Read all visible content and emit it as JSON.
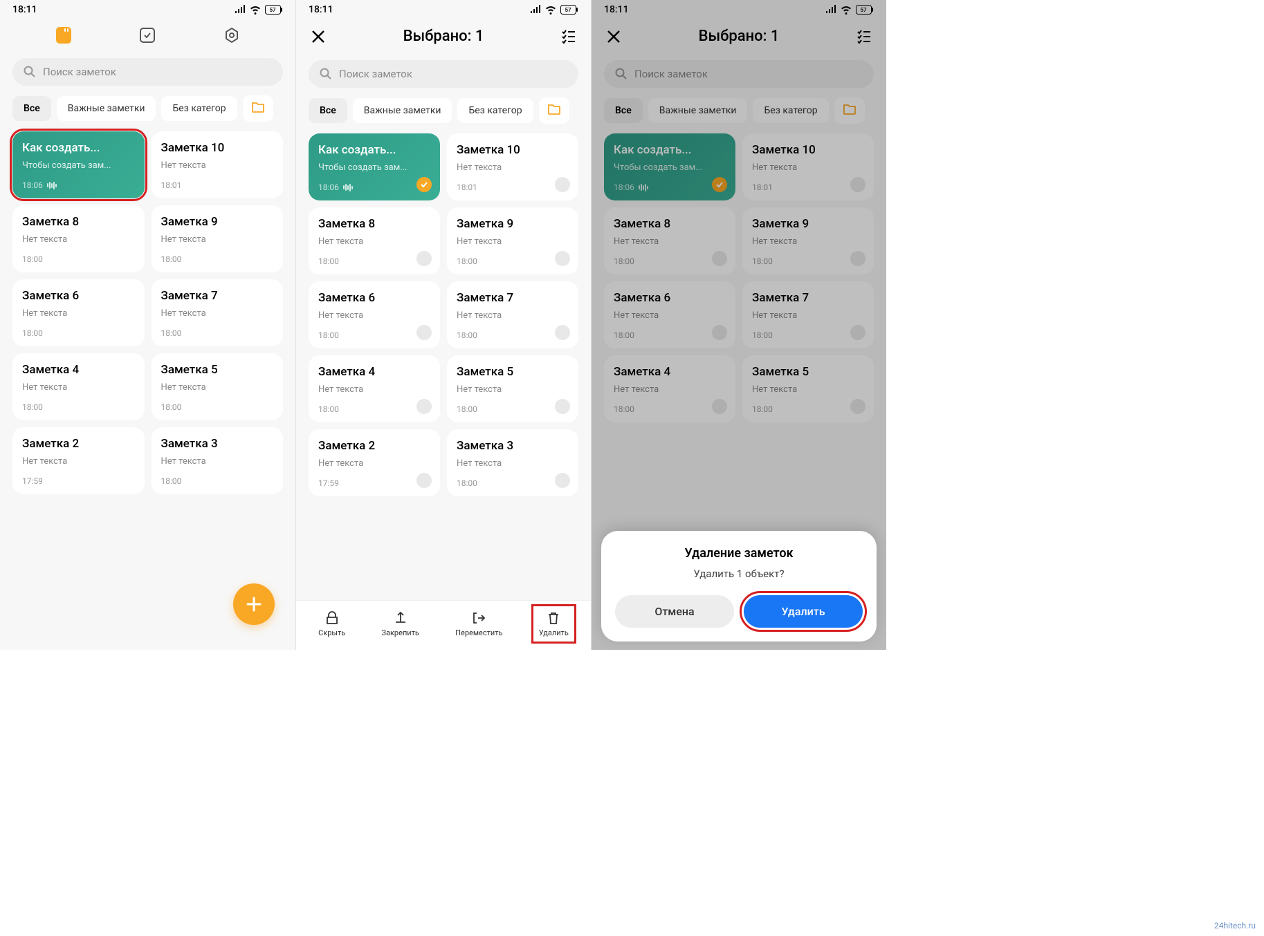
{
  "statusbar": {
    "time": "18:11",
    "battery": "57"
  },
  "selection_header": {
    "title": "Выбрано: 1"
  },
  "search": {
    "placeholder": "Поиск заметок"
  },
  "filters": {
    "all": "Все",
    "important": "Важные заметки",
    "uncategorized": "Без категор"
  },
  "notes": [
    {
      "title": "Как создать...",
      "body": "Чтобы создать зам...",
      "time": "18:06",
      "green": true,
      "audio": true
    },
    {
      "title": "Заметка 10",
      "body": "Нет текста",
      "time": "18:01"
    },
    {
      "title": "Заметка 8",
      "body": "Нет текста",
      "time": "18:00"
    },
    {
      "title": "Заметка 9",
      "body": "Нет текста",
      "time": "18:00"
    },
    {
      "title": "Заметка 6",
      "body": "Нет текста",
      "time": "18:00"
    },
    {
      "title": "Заметка 7",
      "body": "Нет текста",
      "time": "18:00"
    },
    {
      "title": "Заметка 4",
      "body": "Нет текста",
      "time": "18:00"
    },
    {
      "title": "Заметка 5",
      "body": "Нет текста",
      "time": "18:00"
    },
    {
      "title": "Заметка 2",
      "body": "Нет текста",
      "time": "17:59"
    },
    {
      "title": "Заметка 3",
      "body": "Нет текста",
      "time": "18:00"
    }
  ],
  "actions": {
    "hide": "Скрыть",
    "pin": "Закрепить",
    "move": "Переместить",
    "delete": "Удалить"
  },
  "dialog": {
    "title": "Удаление заметок",
    "text": "Удалить 1 объект?",
    "cancel": "Отмена",
    "confirm": "Удалить"
  },
  "watermark": "24hitech.ru"
}
